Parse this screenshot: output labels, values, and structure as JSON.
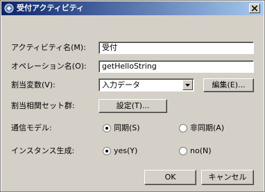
{
  "window": {
    "title": "受付アクティビティ"
  },
  "form": {
    "activity_name": {
      "label": "アクティビティ名(M):",
      "value": "受付"
    },
    "operation_name": {
      "label": "オペレーション名(O):",
      "value": "getHelloString"
    },
    "assign_variable": {
      "label": "割当変数(V):",
      "selected": "入力データ",
      "edit_button": "編集(E)..."
    },
    "correlation_set": {
      "label": "割当相関セット群:",
      "settings_button": "設定(T)..."
    },
    "communication_model": {
      "label": "通信モデル:",
      "options": [
        {
          "label": "同期(S)",
          "checked": true
        },
        {
          "label": "非同期(A)",
          "checked": false
        }
      ]
    },
    "instance_creation": {
      "label": "インスタンス生成:",
      "options": [
        {
          "label": "yes(Y)",
          "checked": true
        },
        {
          "label": "no(N)",
          "checked": false
        }
      ]
    }
  },
  "footer": {
    "ok_label": "OK",
    "cancel_label": "キャンセル"
  },
  "colors": {
    "titlebar_start": "#0a246a",
    "titlebar_end": "#a6caf0",
    "dialog_face": "#d4d0c8"
  }
}
